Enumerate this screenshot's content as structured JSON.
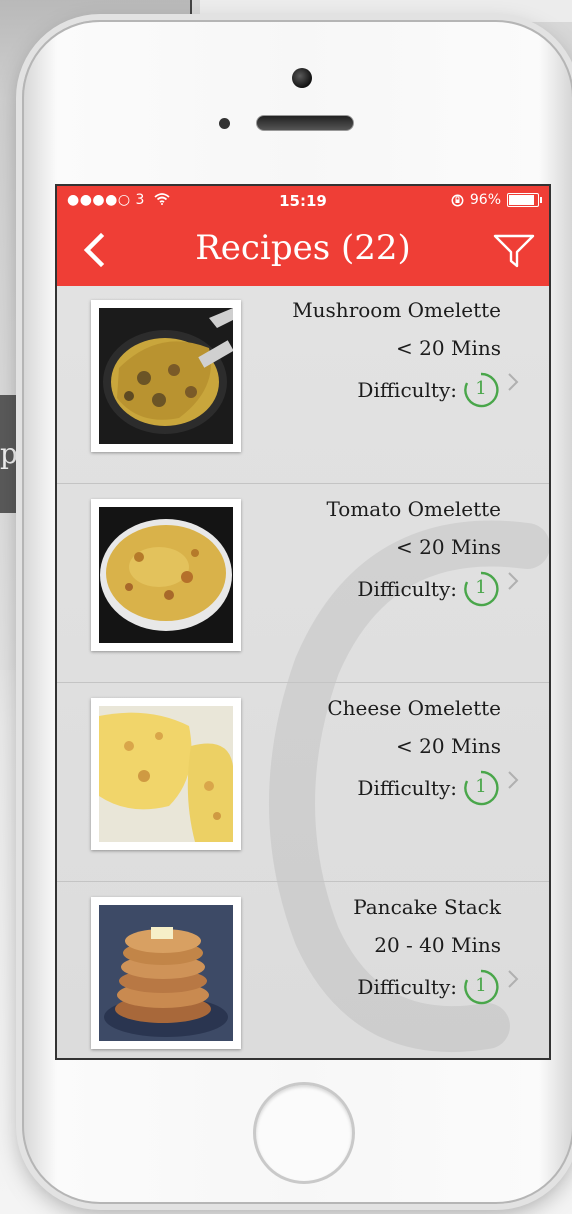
{
  "status_bar": {
    "carrier": "●●●●○ 3",
    "time": "15:19",
    "battery": "96%",
    "battery_level": 0.96
  },
  "nav": {
    "title": "Recipes (22)",
    "back_icon": "chevron-left-icon",
    "filter_icon": "filter-funnel-icon"
  },
  "colors": {
    "accent": "#ef3e36",
    "difficulty_green": "#49a64a"
  },
  "backdrop": {
    "partial_text": "p"
  },
  "recipes": [
    {
      "name": "Mushroom Omelette",
      "time": "< 20 Mins",
      "difficulty_label": "Difficulty:",
      "difficulty": "1"
    },
    {
      "name": "Tomato Omelette",
      "time": "< 20 Mins",
      "difficulty_label": "Difficulty:",
      "difficulty": "1"
    },
    {
      "name": "Cheese Omelette",
      "time": "< 20 Mins",
      "difficulty_label": "Difficulty:",
      "difficulty": "1"
    },
    {
      "name": "Pancake Stack",
      "time": "20 - 40 Mins",
      "difficulty_label": "Difficulty:",
      "difficulty": "1"
    }
  ]
}
